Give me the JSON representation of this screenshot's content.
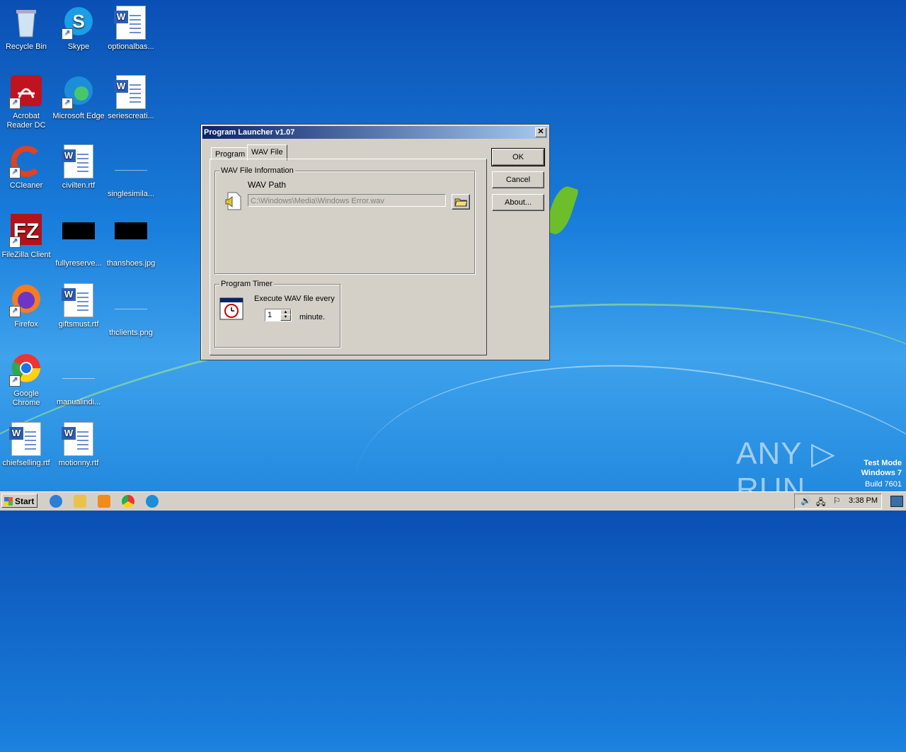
{
  "desktop": {
    "icons": [
      {
        "label": "Recycle Bin"
      },
      {
        "label": "Skype"
      },
      {
        "label": "optionalbas..."
      },
      {
        "label": "Acrobat Reader DC"
      },
      {
        "label": "Microsoft Edge"
      },
      {
        "label": "seriescreati..."
      },
      {
        "label": "CCleaner"
      },
      {
        "label": "civilten.rtf"
      },
      {
        "label": "singlesimila..."
      },
      {
        "label": "FileZilla Client"
      },
      {
        "label": "fullyreserve..."
      },
      {
        "label": "thanshoes.jpg"
      },
      {
        "label": "Firefox"
      },
      {
        "label": "giftsmust.rtf"
      },
      {
        "label": "thclients.png"
      },
      {
        "label": "Google Chrome"
      },
      {
        "label": "manualindi..."
      },
      {
        "label": "chiefselling.rtf"
      },
      {
        "label": "motionny.rtf"
      }
    ]
  },
  "dialog": {
    "title": "Program Launcher v1.07",
    "close": "✕",
    "tabs": [
      "Program",
      "WAV File"
    ],
    "active_tab": "WAV File",
    "wav_group": {
      "legend": "WAV File Information",
      "path_label": "WAV Path",
      "path_value": "C:\\Windows\\Media\\Windows Error.wav"
    },
    "timer_group": {
      "legend": "Program Timer",
      "execute_label": "Execute WAV file every",
      "interval": "1",
      "unit": "minute."
    },
    "buttons": {
      "ok": "OK",
      "cancel": "Cancel",
      "about": "About..."
    }
  },
  "taskbar": {
    "start": "Start",
    "time": "3:38 PM"
  },
  "watermark": {
    "line1": "Test Mode",
    "line2": "Windows 7",
    "line3": "Build 7601",
    "brand": "ANY ▷ RUN"
  }
}
